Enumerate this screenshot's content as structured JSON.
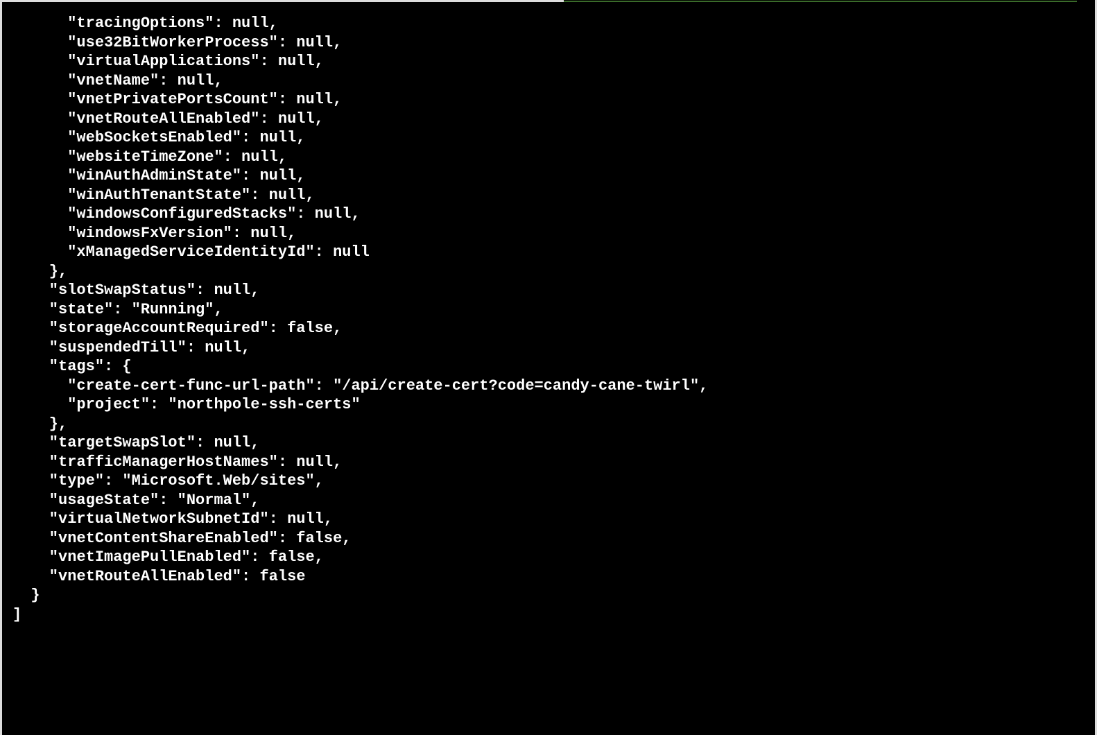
{
  "terminal": {
    "lines": [
      "      \"tracingOptions\": null,",
      "      \"use32BitWorkerProcess\": null,",
      "      \"virtualApplications\": null,",
      "      \"vnetName\": null,",
      "      \"vnetPrivatePortsCount\": null,",
      "      \"vnetRouteAllEnabled\": null,",
      "      \"webSocketsEnabled\": null,",
      "      \"websiteTimeZone\": null,",
      "      \"winAuthAdminState\": null,",
      "      \"winAuthTenantState\": null,",
      "      \"windowsConfiguredStacks\": null,",
      "      \"windowsFxVersion\": null,",
      "      \"xManagedServiceIdentityId\": null",
      "    },",
      "    \"slotSwapStatus\": null,",
      "    \"state\": \"Running\",",
      "    \"storageAccountRequired\": false,",
      "    \"suspendedTill\": null,",
      "    \"tags\": {",
      "      \"create-cert-func-url-path\": \"/api/create-cert?code=candy-cane-twirl\",",
      "      \"project\": \"northpole-ssh-certs\"",
      "    },",
      "    \"targetSwapSlot\": null,",
      "    \"trafficManagerHostNames\": null,",
      "    \"type\": \"Microsoft.Web/sites\",",
      "    \"usageState\": \"Normal\",",
      "    \"virtualNetworkSubnetId\": null,",
      "    \"vnetContentShareEnabled\": false,",
      "    \"vnetImagePullEnabled\": false,",
      "    \"vnetRouteAllEnabled\": false",
      "  }",
      "]"
    ]
  }
}
